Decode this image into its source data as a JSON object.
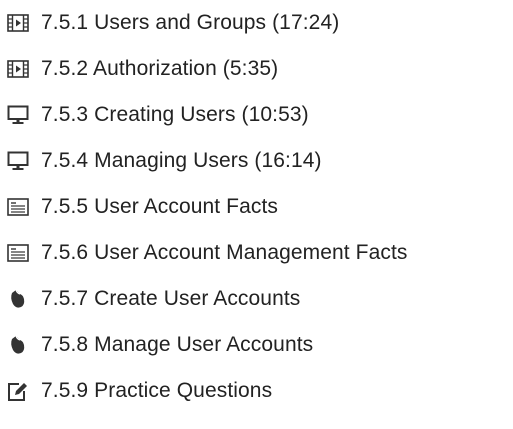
{
  "lesson_items": [
    {
      "label": "7.5.1 Users and Groups (17:24)",
      "icon": "video-icon"
    },
    {
      "label": "7.5.2 Authorization (5:35)",
      "icon": "video-icon"
    },
    {
      "label": "7.5.3 Creating Users (10:53)",
      "icon": "monitor-icon"
    },
    {
      "label": "7.5.4 Managing Users (16:14)",
      "icon": "monitor-icon"
    },
    {
      "label": "7.5.5 User Account Facts",
      "icon": "document-icon"
    },
    {
      "label": "7.5.6 User Account Management Facts",
      "icon": "document-icon"
    },
    {
      "label": "7.5.7 Create User Accounts",
      "icon": "mouse-icon"
    },
    {
      "label": "7.5.8 Manage User Accounts",
      "icon": "mouse-icon"
    },
    {
      "label": "7.5.9 Practice Questions",
      "icon": "edit-icon"
    }
  ],
  "colors": {
    "text": "#222222",
    "icon": "#333333",
    "background": "#ffffff"
  }
}
